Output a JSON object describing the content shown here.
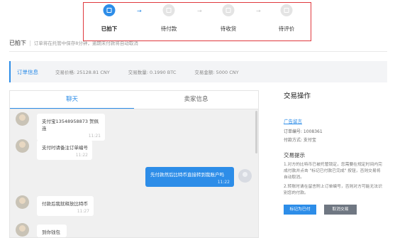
{
  "steps": [
    {
      "label": "已拍下",
      "icon": "clipboard-icon",
      "active": true
    },
    {
      "label": "待付款",
      "icon": "wallet-icon",
      "active": false
    },
    {
      "label": "待收货",
      "icon": "box-icon",
      "active": false
    },
    {
      "label": "待评价",
      "icon": "star-icon",
      "active": false
    }
  ],
  "status": {
    "title": "已拍下",
    "note": "订单将在托管中保存8分钟，逾期未付款将自动取消"
  },
  "order_info": {
    "title": "订单信息",
    "price": "交易价格: 25128.81 CNY",
    "quantity": "交易数量: 0.1990 BTC",
    "amount": "交易金额: 5000 CNY"
  },
  "chat": {
    "tabs": [
      "聊天",
      "卖家信息"
    ],
    "messages": [
      {
        "side": "in",
        "text": "支付宝13548958873 贺佩连",
        "time": "11:21"
      },
      {
        "side": "in",
        "text": "支付时请备注订单编号",
        "time": "11:22"
      },
      {
        "side": "out",
        "text": "先付款然后比特币直接转到我账户吗",
        "time": "11:22"
      },
      {
        "side": "in",
        "text": "付款后我就释放比特币",
        "time": "11:27"
      },
      {
        "side": "in",
        "text": "到你钱包",
        "time": ""
      }
    ]
  },
  "ops": {
    "title": "交易操作",
    "ad_link": "广告留言",
    "order_no": "订单编号: 1008361",
    "pay_method": "付款方式: 支付宝",
    "tips_title": "交易提示",
    "tip1": "1.对方的比特币已被托管锁定，您需要在规定时间内完成付款并点击 \"标记已付款已完成\" 按钮，否则交易将自动取消。",
    "tip2": "2.转账时请在留言附上订单编号，否则对方可能无法识别您的付款。",
    "mark_paid": "标记为已付款完成",
    "cancel": "取消交易"
  },
  "colors": {
    "accent": "#2d8de8",
    "highlight_border": "#e0393e"
  }
}
